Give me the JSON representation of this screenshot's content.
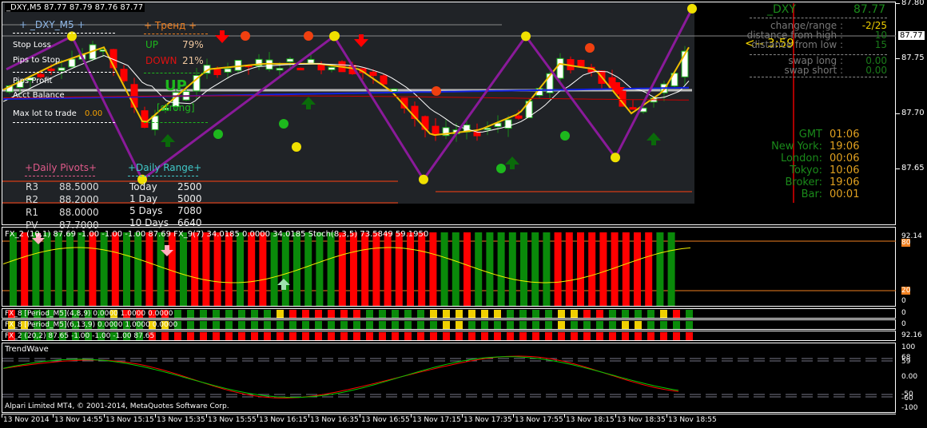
{
  "header": {
    "symbol": "_DXY,M5",
    "ohlc": "87.77 87.79 87.76 87.77"
  },
  "panel_left": {
    "title": "+ _DXY_M5 +",
    "rows": [
      {
        "label": "Stop Loss"
      },
      {
        "label": "Pips to Stop"
      },
      {
        "label": "Pips Profit"
      },
      {
        "label": "Acct Balance"
      },
      {
        "label": "Max lot to trade",
        "value": "0.00"
      }
    ]
  },
  "trend": {
    "title": "+ Тренд +",
    "up_label": "UP",
    "up_value": "79%",
    "down_label": "DOWN",
    "down_value": "21%",
    "signal": "UP",
    "strength": "[strong]"
  },
  "pivots": {
    "title": "+Daily Pivots+",
    "rows": [
      {
        "name": "R3",
        "value": "88.5000"
      },
      {
        "name": "R2",
        "value": "88.2000"
      },
      {
        "name": "R1",
        "value": "88.0000"
      },
      {
        "name": "PV",
        "value": "87.7000"
      }
    ]
  },
  "range": {
    "title": "+Daily Range+",
    "rows": [
      {
        "name": "Today",
        "value": "2500"
      },
      {
        "name": "1 Day",
        "value": "5000"
      },
      {
        "name": "5 Days",
        "value": "7080"
      },
      {
        "name": "10 Days",
        "value": "6640"
      }
    ]
  },
  "info": {
    "symbol": "_DXY",
    "price": "87.77",
    "rows": [
      {
        "label": "change/range :",
        "value": "-2/25"
      },
      {
        "label": "distance from high :",
        "value": "10"
      },
      {
        "label": "distance from low :",
        "value": "15"
      },
      {
        "label": "swap long :",
        "value": "0.00"
      },
      {
        "label": "swap short :",
        "value": "0.00"
      }
    ],
    "countdown": "<-- 3:59"
  },
  "clock": [
    {
      "label": "GMT",
      "value": "01:06"
    },
    {
      "label": "New York:",
      "value": "19:06"
    },
    {
      "label": "London:",
      "value": "00:06"
    },
    {
      "label": "Tokyo:",
      "value": "10:06"
    },
    {
      "label": "Broker:",
      "value": "19:06"
    },
    {
      "label": "Bar:",
      "value": "00:01"
    }
  ],
  "price_axis": {
    "ticks": [
      "87.80",
      "87.75",
      "87.70",
      "87.65"
    ],
    "current": "87.77"
  },
  "chart_data": {
    "type": "candlestick",
    "price_path": [
      [
        0,
        87.72
      ],
      [
        70,
        87.745
      ],
      [
        130,
        87.76
      ],
      [
        180,
        87.69
      ],
      [
        260,
        87.74
      ],
      [
        330,
        87.745
      ],
      [
        400,
        87.745
      ],
      [
        450,
        87.74
      ],
      [
        490,
        87.72
      ],
      [
        540,
        87.68
      ],
      [
        600,
        87.685
      ],
      [
        650,
        87.7
      ],
      [
        700,
        87.745
      ],
      [
        745,
        87.74
      ],
      [
        790,
        87.7
      ],
      [
        830,
        87.72
      ],
      [
        866,
        87.765
      ]
    ],
    "zigzag": [
      [
        87.74,
        0
      ],
      [
        87.77,
        1
      ],
      [
        87.64,
        2
      ],
      [
        87.77,
        3
      ],
      [
        87.64,
        4
      ],
      [
        87.77,
        5
      ],
      [
        87.66,
        6
      ],
      [
        87.795,
        7
      ]
    ]
  },
  "indicators": {
    "stoch_label": "FX_2 (10,1) 87.69 -1.00 -1.00 -1.00 87.69  FX_9(7) 34.0185 0.0000 34.0185  Stoch(8,3,5) 73.5849 59.1950",
    "stoch_axis": [
      "92.14",
      "80",
      "20",
      "0"
    ],
    "stoch_colors": "GRGGGGGRGRGGRGRGRRRRGRRGGGGGGRRRRRRRRRGGRGGGGGGGRRRRRRRRRGG",
    "fx8a_label": "FX_8 [Period_M5](4,8,9) 0.0000 1.0000 0.0000",
    "fx8a_colors": "RGGGGGGGYRRRRGGGGGGGGYRRRRRRGGGGGYYYYYYGGGGYYRRGGGGYRG",
    "fx8b_label": "FX_8 [Period_M5](6,13,9) 0.0000 1.0000 0.0000",
    "fx8b_colors": "YYGGGGGGGGGYYGGGGGGGGGGGGGGGGGGGGGYYGGGGGGGYGGGGYYGGGG",
    "fx2_label": "FX_2 (20,2) 87.65 -1.00 -1.00 -1.00 87.65",
    "fx2_colors": "RGGGGGGGGGGRRRRRRRRRRRRRRRRRRRRRRRRRRRRRRRRRRRRRRRRRRR",
    "small_axis": [
      "0",
      "0",
      "92.16"
    ],
    "trendwave_label": "TrendWave",
    "trendwave_axis": [
      "100",
      "68",
      "59",
      "0.00",
      "-50",
      "-60",
      "-100"
    ]
  },
  "footer": {
    "copyright": "Alpari Limited MT4, © 2001-2014, MetaQuotes Software Corp."
  },
  "time_axis": [
    "13 Nov 2014",
    "13 Nov 14:55",
    "13 Nov 15:15",
    "13 Nov 15:35",
    "13 Nov 15:55",
    "13 Nov 16:15",
    "13 Nov 16:35",
    "13 Nov 16:55",
    "13 Nov 17:15",
    "13 Nov 17:35",
    "13 Nov 17:55",
    "13 Nov 18:15",
    "13 Nov 18:35",
    "13 Nov 18:55"
  ]
}
